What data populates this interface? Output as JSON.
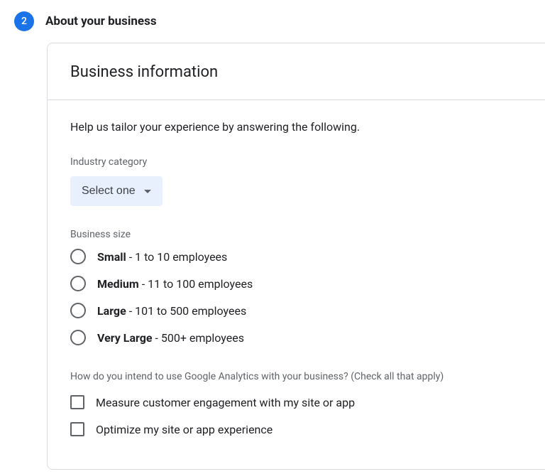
{
  "step": {
    "number": "2",
    "title": "About your business"
  },
  "card": {
    "title": "Business information",
    "intro": "Help us tailor your experience by answering the following."
  },
  "industry": {
    "label": "Industry category",
    "selected": "Select one"
  },
  "business_size": {
    "label": "Business size",
    "options": [
      {
        "bold": "Small",
        "rest": " - 1 to 10 employees"
      },
      {
        "bold": "Medium",
        "rest": " - 11 to 100 employees"
      },
      {
        "bold": "Large",
        "rest": " - 101 to 500 employees"
      },
      {
        "bold": "Very Large",
        "rest": " - 500+ employees"
      }
    ]
  },
  "usage": {
    "label": "How do you intend to use Google Analytics with your business? (Check all that apply)",
    "options": [
      "Measure customer engagement with my site or app",
      "Optimize my site or app experience"
    ]
  }
}
